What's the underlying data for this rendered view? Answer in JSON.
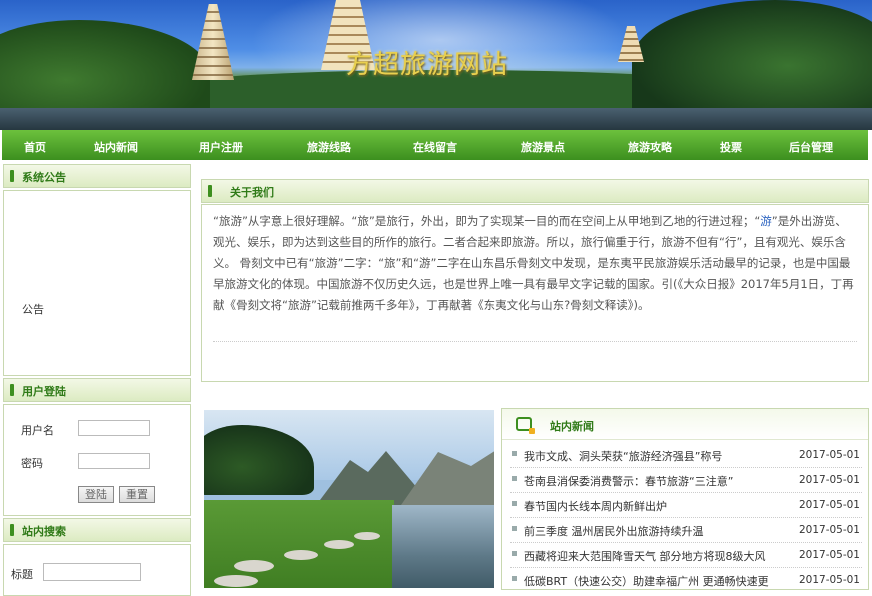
{
  "site": {
    "title": "方超旅游网站"
  },
  "nav": {
    "items": [
      "首页",
      "站内新闻",
      "用户注册",
      "旅游线路",
      "在线留言",
      "旅游景点",
      "旅游攻略",
      "投票",
      "后台管理"
    ]
  },
  "sidebar": {
    "notice": {
      "title": "系统公告",
      "content": "公告"
    },
    "login": {
      "title": "用户登陆",
      "username_label": "用户名",
      "password_label": "密码",
      "login_button": "登陆",
      "reset_button": "重置",
      "username_value": "",
      "password_value": ""
    },
    "search": {
      "title": "站内搜索",
      "field_label": "标题",
      "field_value": ""
    }
  },
  "about": {
    "title": "关于我们",
    "text_before_link": "“旅游”从字意上很好理解。“旅”是旅行，外出，即为了实现某一目的而在空间上从甲地到乙地的行进过程；“",
    "link_text": "游",
    "text_after_link": "”是外出游览、观光、娱乐，即为达到这些目的所作的旅行。二者合起来即旅游。所以，旅行偏重于行，旅游不但有“行”，且有观光、娱乐含义。 骨刻文中已有“旅游”二字：“旅”和“游”二字在山东昌乐骨刻文中发现，是东夷平民旅游娱乐活动最早的记录，也是中国最早旅游文化的体现。中国旅游不仅历史久远，也是世界上唯一具有最早文字记载的国家。引(《大众日报》2017年5月1日，丁再献《骨刻文将“旅游”记载前推两千多年》，丁再献著《东夷文化与山东?骨刻文释读》)。"
  },
  "news": {
    "title": "站内新闻",
    "items": [
      {
        "title": "我市文成、洞头荣获“旅游经济强县”称号",
        "date": "2017-05-01"
      },
      {
        "title": "苍南县消保委消费警示：春节旅游“三注意”",
        "date": "2017-05-01"
      },
      {
        "title": "春节国内长线本周内新鲜出炉",
        "date": "2017-05-01"
      },
      {
        "title": "前三季度 温州居民外出旅游持续升温",
        "date": "2017-05-01"
      },
      {
        "title": "西藏将迎来大范围降雪天气 部分地方将现8级大风",
        "date": "2017-05-01"
      },
      {
        "title": "低碳BRT（快速公交）助建幸福广州 更通畅快速更",
        "date": "2017-05-01"
      }
    ]
  },
  "colors": {
    "nav_green": "#4fa82a",
    "title_gold": "#e9d04e",
    "header_green": "#2f7a17"
  }
}
